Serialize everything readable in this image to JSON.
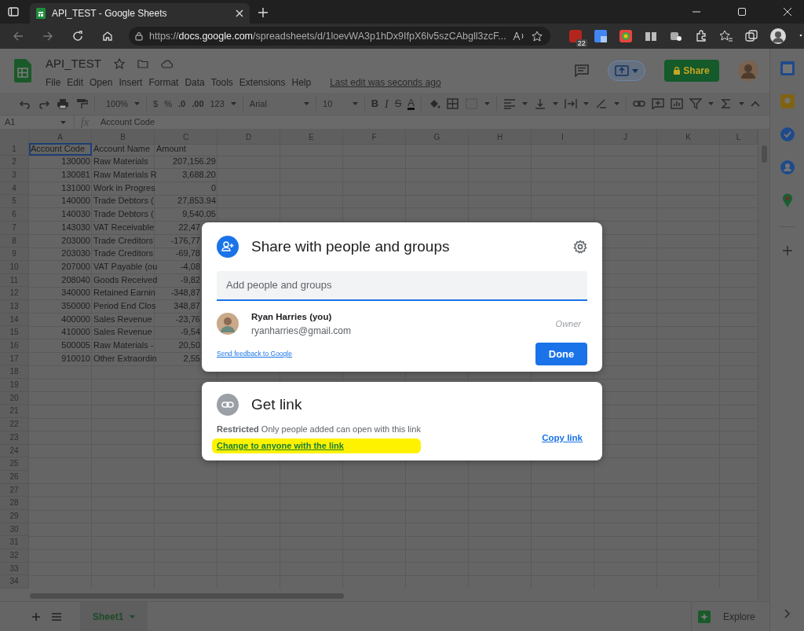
{
  "browser": {
    "tab_title": "API_TEST - Google Sheets",
    "url_prefix": "https://",
    "url_host": "docs.google.com",
    "url_path": "/spreadsheets/d/1loevWA3p1hDx9IfpX6lv5szCAbgll3zcF...",
    "extension_badge": "22"
  },
  "document": {
    "title": "API_TEST",
    "menus": [
      "File",
      "Edit",
      "Open",
      "Insert",
      "Format",
      "Data",
      "Tools",
      "Extensions",
      "Help"
    ],
    "last_edit": "Last edit was seconds ago",
    "share_button": "Share"
  },
  "toolbar": {
    "zoom": "100%",
    "currency": "$",
    "percent": "%",
    "decrease_decimals": ".0",
    "increase_decimals": ".00",
    "number_format": "123",
    "font": "Arial",
    "font_size": "10",
    "bold": "B",
    "italic": "I",
    "strikethrough": "S",
    "text_color": "A"
  },
  "formula_bar": {
    "cell_ref": "A1",
    "fx": "fx",
    "content": "Account Code"
  },
  "columns": [
    "A",
    "B",
    "C",
    "D",
    "E",
    "F",
    "G",
    "H",
    "I",
    "J",
    "K",
    "L"
  ],
  "rows": [
    {
      "number": "1",
      "code": "Account Code",
      "name": "Account Name",
      "amount": "Amount",
      "selected": true,
      "covered": false
    },
    {
      "number": "2",
      "code": "130000",
      "name": "Raw Materials",
      "amount": "207,156.29",
      "selected": false,
      "covered": false
    },
    {
      "number": "3",
      "code": "130081",
      "name": "Raw Materials R",
      "amount": "3,688.20",
      "selected": false,
      "covered": false
    },
    {
      "number": "4",
      "code": "131000",
      "name": "Work in Progres",
      "amount": "0",
      "selected": false,
      "covered": false
    },
    {
      "number": "5",
      "code": "140000",
      "name": "Trade Debtors (",
      "amount": "27,853.94",
      "selected": false,
      "covered": false
    },
    {
      "number": "6",
      "code": "140030",
      "name": "Trade Debtors (",
      "amount": "9,540.05",
      "selected": false,
      "covered": false
    },
    {
      "number": "7",
      "code": "143030",
      "name": "VAT Receivable",
      "amount": "22,47",
      "selected": false,
      "covered": true
    },
    {
      "number": "8",
      "code": "203000",
      "name": "Trade Creditors",
      "amount": "-176,77",
      "selected": false,
      "covered": true
    },
    {
      "number": "9",
      "code": "203030",
      "name": "Trade Creditors",
      "amount": "-69,78",
      "selected": false,
      "covered": true
    },
    {
      "number": "10",
      "code": "207000",
      "name": "VAT Payable (ou",
      "amount": "-4,08",
      "selected": false,
      "covered": true
    },
    {
      "number": "11",
      "code": "208040",
      "name": "Goods Received",
      "amount": "-9,82",
      "selected": false,
      "covered": true
    },
    {
      "number": "12",
      "code": "340000",
      "name": "Retained Earnin",
      "amount": "-348,87",
      "selected": false,
      "covered": true
    },
    {
      "number": "13",
      "code": "350000",
      "name": "Period End Clos",
      "amount": "348,87",
      "selected": false,
      "covered": true
    },
    {
      "number": "14",
      "code": "400000",
      "name": "Sales Revenue",
      "amount": "-23,76",
      "selected": false,
      "covered": true
    },
    {
      "number": "15",
      "code": "410000",
      "name": "Sales Revenue",
      "amount": "-9,54",
      "selected": false,
      "covered": true
    },
    {
      "number": "16",
      "code": "500005",
      "name": "Raw Materials -",
      "amount": "20,50",
      "selected": false,
      "covered": true
    },
    {
      "number": "17",
      "code": "910010",
      "name": "Other Extraordin",
      "amount": "2,55",
      "selected": false,
      "covered": true
    }
  ],
  "empty_rows": [
    "18",
    "19",
    "20",
    "21",
    "22",
    "23",
    "24",
    "25",
    "26",
    "27",
    "28",
    "29",
    "30",
    "31",
    "32",
    "33",
    "34"
  ],
  "sheet_tabs": [
    {
      "label": "Sheet1",
      "selected": true
    }
  ],
  "explore_button": "Explore",
  "share_dialog": {
    "title": "Share with people and groups",
    "placeholder": "Add people and groups",
    "people": [
      {
        "name": "Ryan Harries (you)",
        "email": "ryanharries@gmail.com",
        "role": "Owner"
      }
    ],
    "feedback_link": "Send feedback to Google",
    "done_button": "Done"
  },
  "link_dialog": {
    "title": "Get link",
    "description": "**Restricted** Only people added can open with this link",
    "change_link": "Change to anyone with the link",
    "highlighted": true,
    "copy_link": "Copy link"
  }
}
